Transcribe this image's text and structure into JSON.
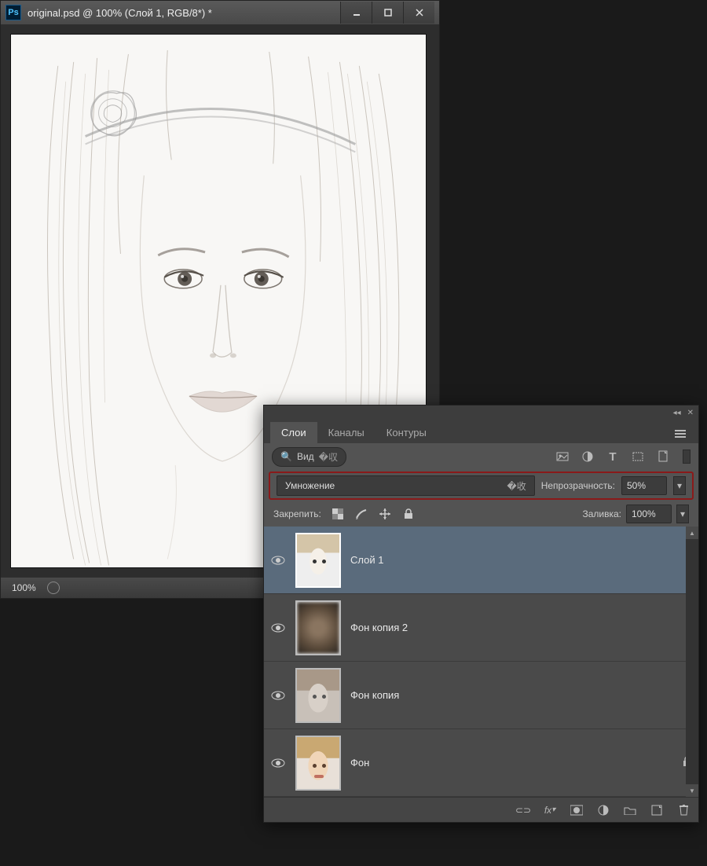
{
  "docwin": {
    "title": "original.psd @ 100% (Слой 1, RGB/8*) *",
    "zoom": "100%"
  },
  "panel": {
    "tabs": [
      "Слои",
      "Каналы",
      "Контуры"
    ],
    "active_tab": 0,
    "filter_label": "Вид",
    "blend_mode": "Умножение",
    "opacity_label": "Непрозрачность:",
    "opacity_value": "50%",
    "lock_label": "Закрепить:",
    "fill_label": "Заливка:",
    "fill_value": "100%",
    "layers": [
      {
        "name": "Слой 1",
        "selected": true,
        "locked": false,
        "thumb": "sketch"
      },
      {
        "name": "Фон копия 2",
        "selected": false,
        "locked": false,
        "thumb": "blur"
      },
      {
        "name": "Фон копия",
        "selected": false,
        "locked": false,
        "thumb": "gray"
      },
      {
        "name": "Фон",
        "selected": false,
        "locked": true,
        "thumb": "color"
      }
    ]
  }
}
